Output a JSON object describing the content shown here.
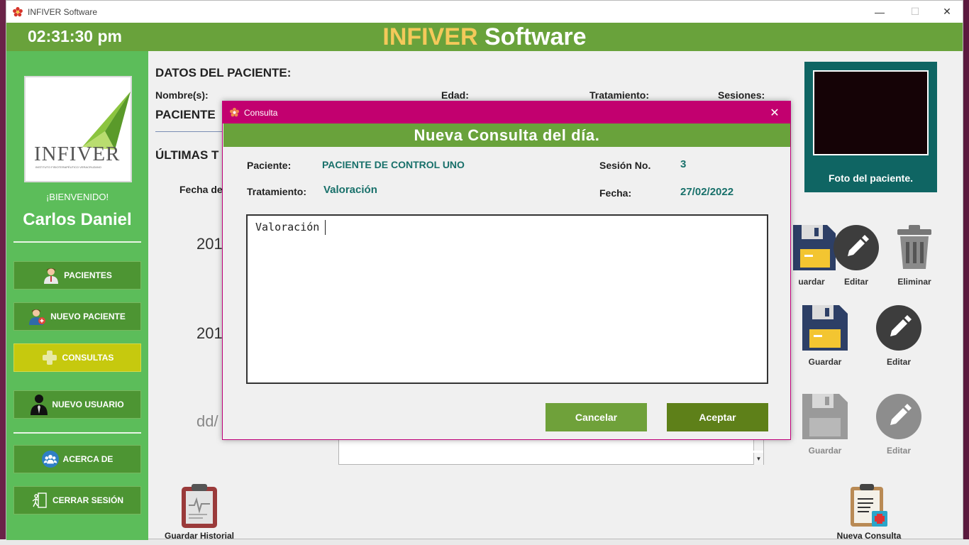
{
  "window": {
    "title": "INFIVER Software",
    "minimize": "—",
    "maximize": "☐",
    "close": "✕"
  },
  "header": {
    "clock": "02:31:30 pm",
    "title_highlight": "INFIVER",
    "title_rest": " Software"
  },
  "sidebar": {
    "logo_text": "INFIVER",
    "logo_subtext": "INSTITUTO FISIOTERAPÉUTICO VERACRUZANO",
    "welcome": "¡BIENVENIDO!",
    "user_name": "Carlos Daniel",
    "items": [
      {
        "label": "PACIENTES",
        "icon": "patient-icon"
      },
      {
        "label": "NUEVO PACIENTE",
        "icon": "add-patient-icon"
      },
      {
        "label": "CONSULTAS",
        "icon": "consultation-icon",
        "active": true
      },
      {
        "label": "NUEVO USUARIO",
        "icon": "user-suit-icon"
      },
      {
        "label": "ACERCA DE",
        "icon": "group-icon"
      },
      {
        "label": "CERRAR SESIÓN",
        "icon": "logout-icon"
      }
    ]
  },
  "main": {
    "patient_section_title": "DATOS DEL PACIENTE:",
    "labels": {
      "name": "Nombre(s):",
      "age": "Edad:",
      "treatment": "Tratamiento:",
      "sessions": "Sesiones:"
    },
    "patient_name_partial": "PACIENTE",
    "latest_title_partial": "ÚLTIMAS T",
    "date_label_partial": "Fecha de",
    "row_dates": [
      "201",
      "201",
      "dd/"
    ],
    "photo_label": "Foto del paciente.",
    "row1_actions": [
      "uardar",
      "Editar",
      "Eliminar"
    ],
    "row2_actions": [
      "Guardar",
      "Editar"
    ],
    "row3_actions": [
      "Guardar",
      "Editar"
    ],
    "save_history": "Guardar Historial",
    "new_consultation": "Nueva Consulta"
  },
  "dialog": {
    "title": "Consulta",
    "close": "✕",
    "header": "Nueva Consulta del día.",
    "patient_label": "Paciente:",
    "patient_value": "PACIENTE DE CONTROL UNO",
    "session_label": "Sesión No.",
    "session_value": "3",
    "treatment_label": "Tratamiento:",
    "treatment_value": "Valoración",
    "date_label": "Fecha:",
    "date_value": "27/02/2022",
    "notes": "Valoración",
    "cancel": "Cancelar",
    "accept": "Aceptar"
  },
  "colors": {
    "header_green": "#69a23b",
    "sidebar_green": "#5cbd5a",
    "nav_button": "#4d9533",
    "nav_active": "#c6c90e",
    "dialog_titlebar": "#c2006f",
    "dialog_value_teal": "#18706a",
    "cancel_button": "#6fa13a",
    "accept_button": "#5e8019",
    "photo_frame": "#0f6563"
  }
}
